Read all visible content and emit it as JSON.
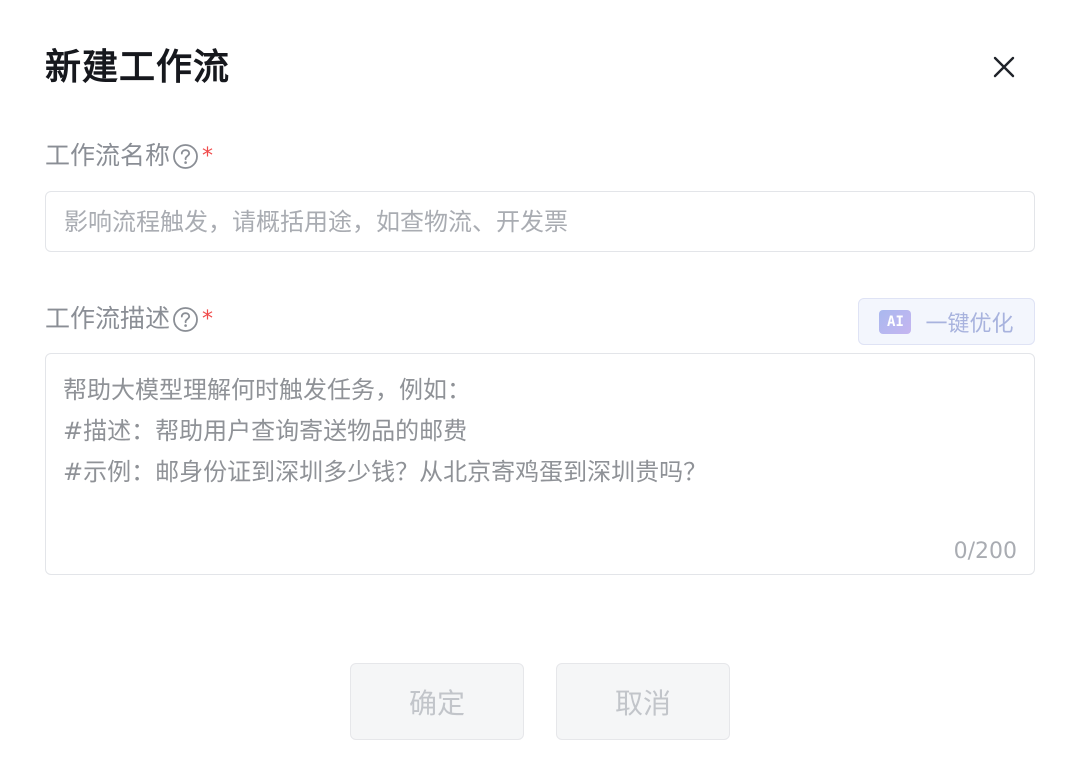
{
  "dialog": {
    "title": "新建工作流",
    "close_icon": "close-icon"
  },
  "name_field": {
    "label": "工作流名称",
    "help_icon": "question-circle-icon",
    "required_mark": "*",
    "value": "",
    "placeholder": "影响流程触发，请概括用途，如查物流、开发票"
  },
  "description_field": {
    "label": "工作流描述",
    "help_icon": "question-circle-icon",
    "required_mark": "*",
    "value": "",
    "placeholder": "帮助大模型理解何时触发任务，例如：\n#描述：帮助用户查询寄送物品的邮费\n#示例：邮身份证到深圳多少钱？从北京寄鸡蛋到深圳贵吗？",
    "counter": "0/200"
  },
  "ai_optimize": {
    "badge": "AI",
    "label": "一键优化"
  },
  "footer": {
    "confirm_label": "确定",
    "cancel_label": "取消"
  },
  "colors": {
    "required": "#f04b4b",
    "label": "#8a8e95",
    "placeholder": "#a9acb2",
    "ai_accent": "#a8b3de",
    "disabled_button_bg": "#f5f6f7",
    "disabled_button_text": "#c2c5ca"
  }
}
